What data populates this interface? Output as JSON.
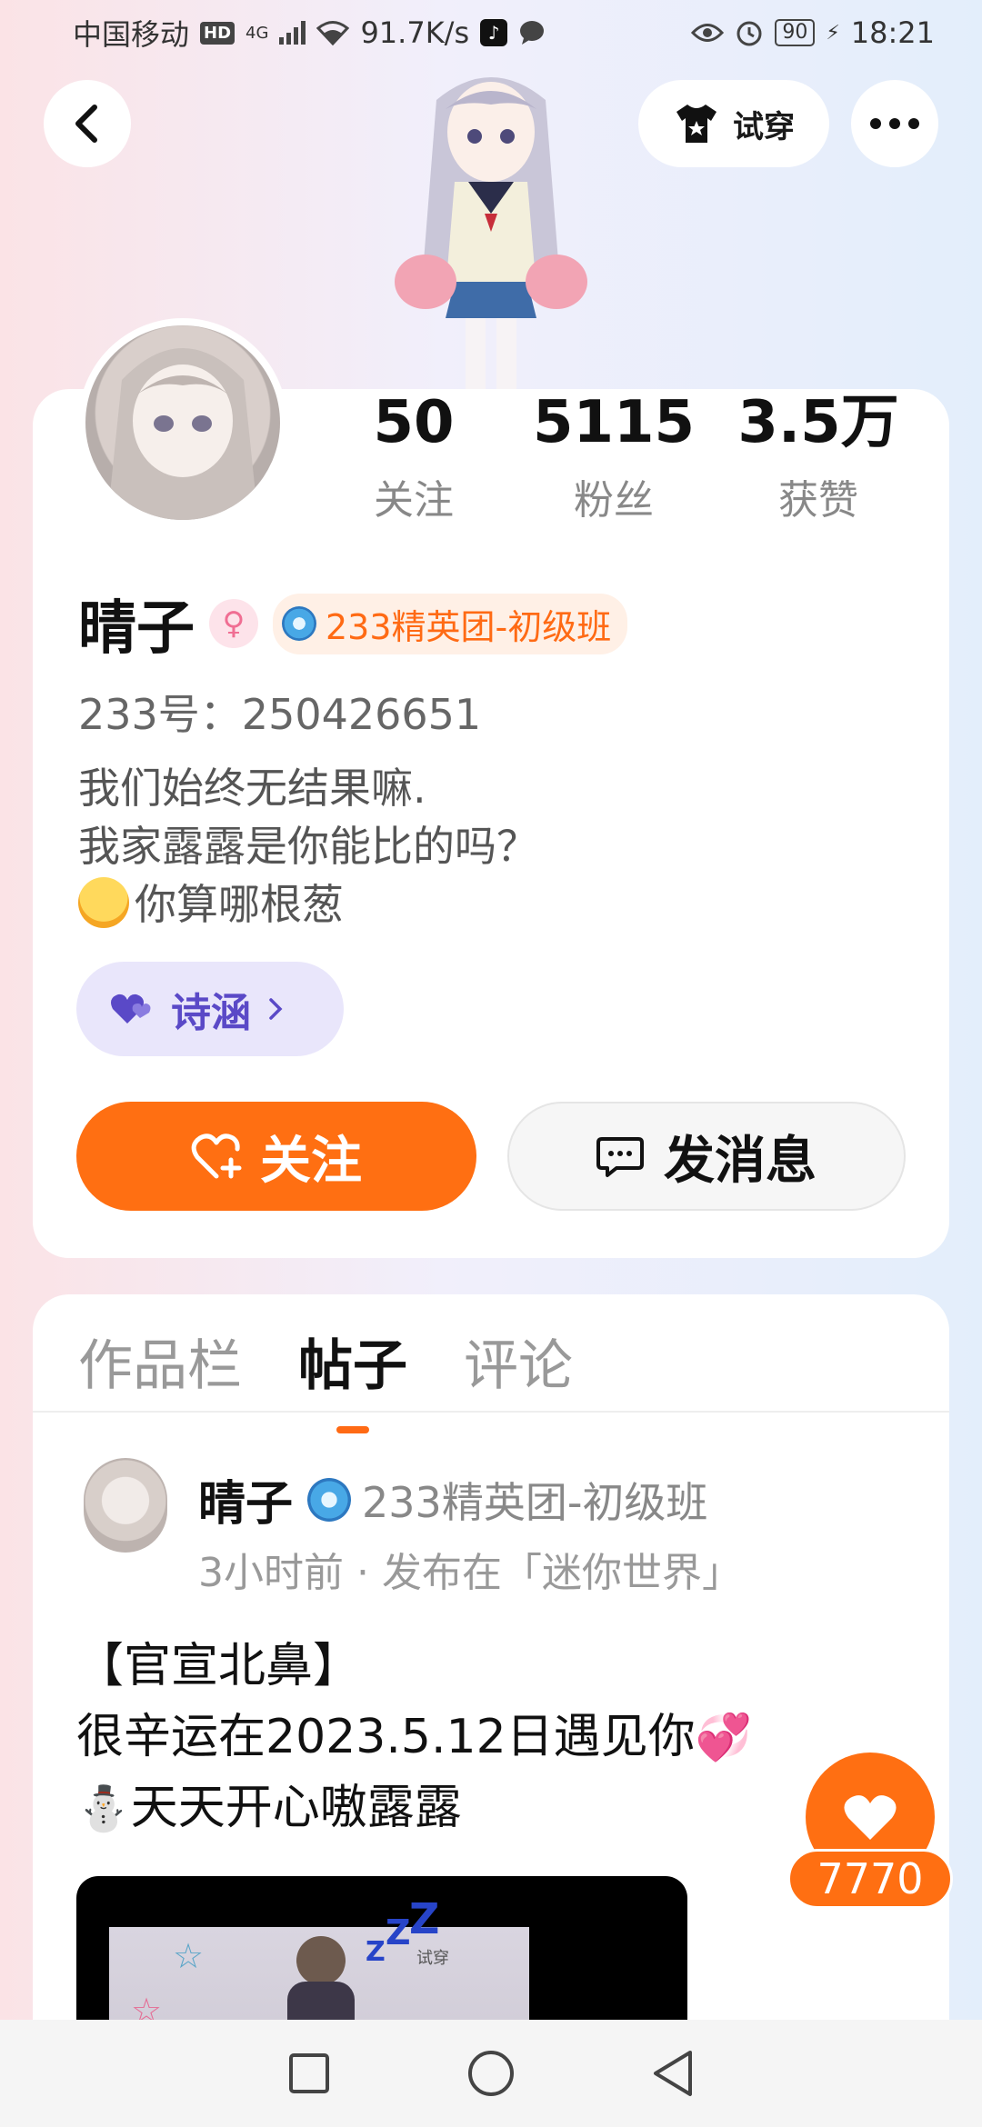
{
  "status_bar": {
    "carrier": "中国移动",
    "hd": "HD",
    "network": "4G",
    "speed": "91.7K/s",
    "battery": "90",
    "time": "18:21"
  },
  "top": {
    "try_on_label": "试穿"
  },
  "profile": {
    "stats": [
      {
        "value": "50",
        "label": "关注"
      },
      {
        "value": "5115",
        "label": "粉丝"
      },
      {
        "value": "3.5万",
        "label": "获赞"
      }
    ],
    "name": "晴子",
    "gender_symbol": "♀",
    "badge": "233精英团-初级班",
    "uid": "233号：250426651",
    "bio_line1": "我们始终无结果嘛.",
    "bio_line2": "我家露露是你能比的吗？",
    "bio_line3": "你算哪根葱",
    "fan_chip_label": "诗涵",
    "follow_label": "关注",
    "message_label": "发消息"
  },
  "tabs": [
    "作品栏",
    "帖子",
    "评论"
  ],
  "post": {
    "author": "晴子",
    "badge": "233精英团-初级班",
    "meta": "3小时前 · 发布在「迷你世界」",
    "line1": "【官宣北鼻】",
    "line2": "很辛运在2023.5.12日遇见你",
    "line3": "天天开心嗷露露",
    "media_caption": "试穿"
  },
  "like": {
    "count": "7770"
  },
  "colors": {
    "accent": "#ff6f12",
    "chip_bg": "#e9e6fb",
    "chip_text": "#5a49c7"
  }
}
